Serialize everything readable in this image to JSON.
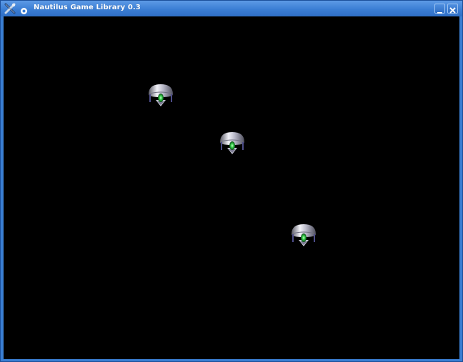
{
  "window": {
    "title": "Nautilus Game Library 0.3",
    "app_icon": "crossed-tools-icon",
    "menu_icon": "window-menu-icon",
    "controls": [
      "minimize-icon",
      "close-icon"
    ]
  },
  "game": {
    "background": "#000000",
    "sprites": [
      {
        "type": "saucer-ship"
      },
      {
        "type": "saucer-ship"
      },
      {
        "type": "saucer-ship"
      }
    ]
  },
  "colors": {
    "titlebar": "#3b7ed4",
    "frame": "#3a7ed2",
    "engine_glow": "#35d04a"
  }
}
